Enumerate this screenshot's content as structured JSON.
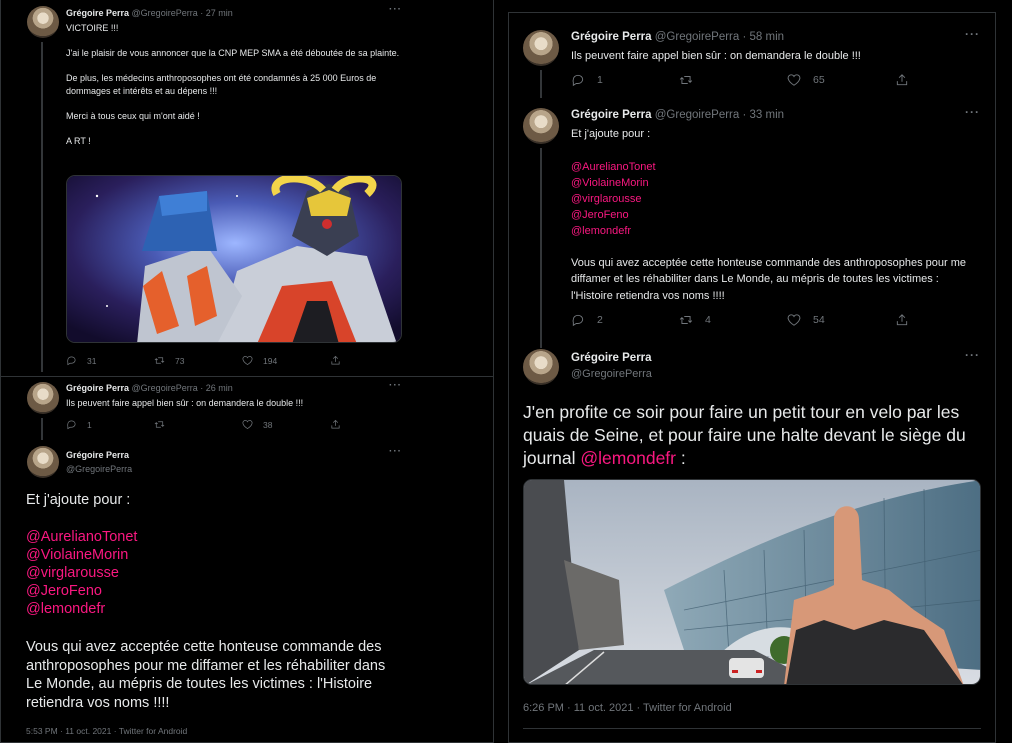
{
  "left": {
    "tweet1": {
      "author": "Grégoire Perra",
      "handle_time": "@GregoirePerra · 27 min",
      "body": "VICTOIRE !!!\n\nJ'ai le plaisir de vous annoncer que la CNP MEP SMA a été déboutée de sa plainte.\n\nDe plus, les médecins anthroposophes ont été condamnés à 25 000 Euros de dommages et intérêts et au dépens !!!\n\nMerci à tous ceux qui m'ont aidé !\n\nA RT  !",
      "replies": "31",
      "retweets": "73",
      "likes": "194"
    },
    "tweet2": {
      "author": "Grégoire Perra",
      "handle_time": "@GregoirePerra · 26 min",
      "body": "Ils peuvent faire appel bien sûr : on demandera le double !!!",
      "replies": "1",
      "retweets": "",
      "likes": "38"
    },
    "tweet3": {
      "author": "Grégoire Perra",
      "handle": "@GregoirePerra",
      "intro": "Et j'ajoute pour :",
      "mentions": [
        "@AurelianoTonet",
        "@ViolaineMorin",
        "@virglarousse",
        "@JeroFeno",
        "@lemondefr"
      ],
      "body": "Vous qui avez acceptée cette honteuse commande des anthroposophes pour me diffamer et les réhabiliter dans Le Monde, au mépris de toutes les victimes : l'Histoire retiendra vos noms !!!!",
      "footer": "5:53 PM · 11 oct. 2021 · Twitter for Android"
    }
  },
  "right": {
    "tweet1": {
      "author": "Grégoire Perra",
      "handle_time": "@GregoirePerra · 58 min",
      "body": "Ils peuvent faire appel bien sûr : on demandera le double !!!",
      "replies": "1",
      "retweets": "",
      "likes": "65"
    },
    "tweet2": {
      "author": "Grégoire Perra",
      "handle_time": "@GregoirePerra · 33 min",
      "intro": "Et j'ajoute pour :",
      "mentions": [
        "@AurelianoTonet",
        "@ViolaineMorin",
        "@virglarousse",
        "@JeroFeno",
        "@lemondefr"
      ],
      "body": "Vous qui avez acceptée cette honteuse commande des anthroposophes pour me diffamer et les réhabiliter dans Le Monde, au mépris de toutes les victimes : l'Histoire retiendra vos noms !!!!",
      "replies": "2",
      "retweets": "4",
      "likes": "54"
    },
    "tweet3": {
      "author": "Grégoire Perra",
      "handle": "@GregoirePerra",
      "body_start": "J'en profite ce soir pour faire un petit tour en velo par les quais de Seine, et pour faire une halte devant le siège du journal ",
      "mention": "@lemondefr",
      "body_end": " :",
      "footer": "6:26 PM · 11 oct. 2021 · Twitter for Android"
    }
  },
  "more_glyph": "···",
  "icons": [
    "reply-icon",
    "retweet-icon",
    "like-icon",
    "share-icon",
    "more-icon"
  ],
  "colors": {
    "background": "#000000",
    "text": "#e7e9ea",
    "muted": "#71767b",
    "mention": "#f91880",
    "border": "#2f3336"
  }
}
